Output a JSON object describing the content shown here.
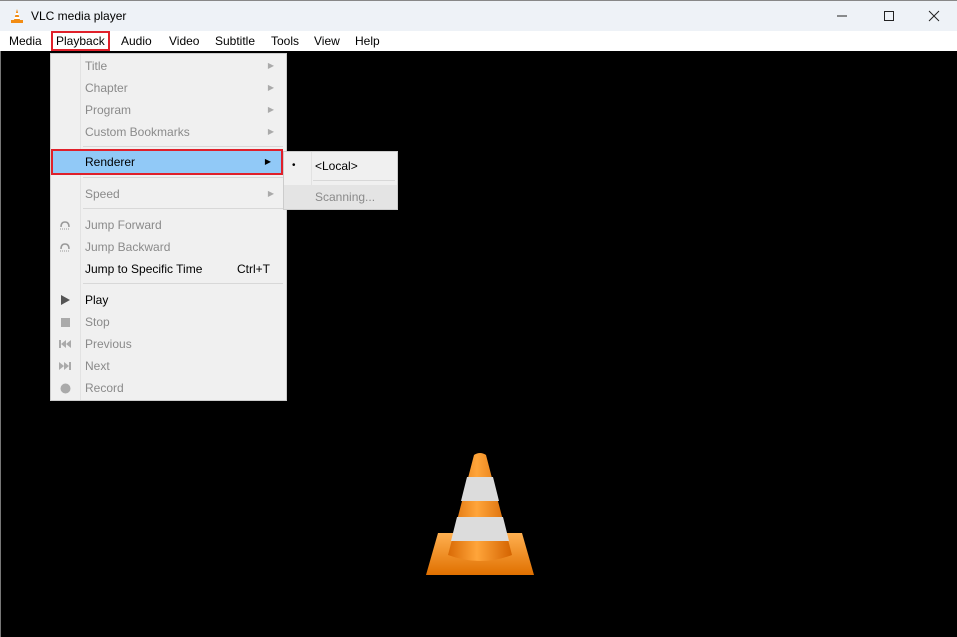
{
  "window": {
    "title": "VLC media player",
    "controls": {
      "minimize": "—",
      "maximize": "☐",
      "close": "✕"
    }
  },
  "menubar": {
    "items": [
      {
        "label": "Media"
      },
      {
        "label": "Playback",
        "active": true
      },
      {
        "label": "Audio"
      },
      {
        "label": "Video"
      },
      {
        "label": "Subtitle"
      },
      {
        "label": "Tools"
      },
      {
        "label": "View"
      },
      {
        "label": "Help"
      }
    ]
  },
  "playback_menu": {
    "items": [
      {
        "label": "Title",
        "enabled": false,
        "submenu": true
      },
      {
        "label": "Chapter",
        "enabled": false,
        "submenu": true
      },
      {
        "label": "Program",
        "enabled": false,
        "submenu": true
      },
      {
        "label": "Custom Bookmarks",
        "enabled": false,
        "submenu": true
      },
      {
        "label": "Renderer",
        "enabled": true,
        "submenu": true,
        "highlighted": true
      },
      {
        "label": "Speed",
        "enabled": false,
        "submenu": true
      },
      {
        "label": "Jump Forward",
        "enabled": false,
        "icon": "jump-forward-icon"
      },
      {
        "label": "Jump Backward",
        "enabled": false,
        "icon": "jump-backward-icon"
      },
      {
        "label": "Jump to Specific Time",
        "enabled": true,
        "shortcut": "Ctrl+T"
      },
      {
        "label": "Play",
        "enabled": true,
        "icon": "play-icon"
      },
      {
        "label": "Stop",
        "enabled": false,
        "icon": "stop-icon"
      },
      {
        "label": "Previous",
        "enabled": false,
        "icon": "previous-icon"
      },
      {
        "label": "Next",
        "enabled": false,
        "icon": "next-icon"
      },
      {
        "label": "Record",
        "enabled": false,
        "icon": "record-icon"
      }
    ],
    "arrow_glyph": "▶"
  },
  "renderer_submenu": {
    "items": [
      {
        "label": "<Local>",
        "selected": true,
        "bullet": "•"
      },
      {
        "label": "Scanning...",
        "enabled": false
      }
    ]
  },
  "colors": {
    "highlight": "#91c9f7",
    "annotation_border": "#e0202a",
    "cone_orange": "#f28c13"
  }
}
